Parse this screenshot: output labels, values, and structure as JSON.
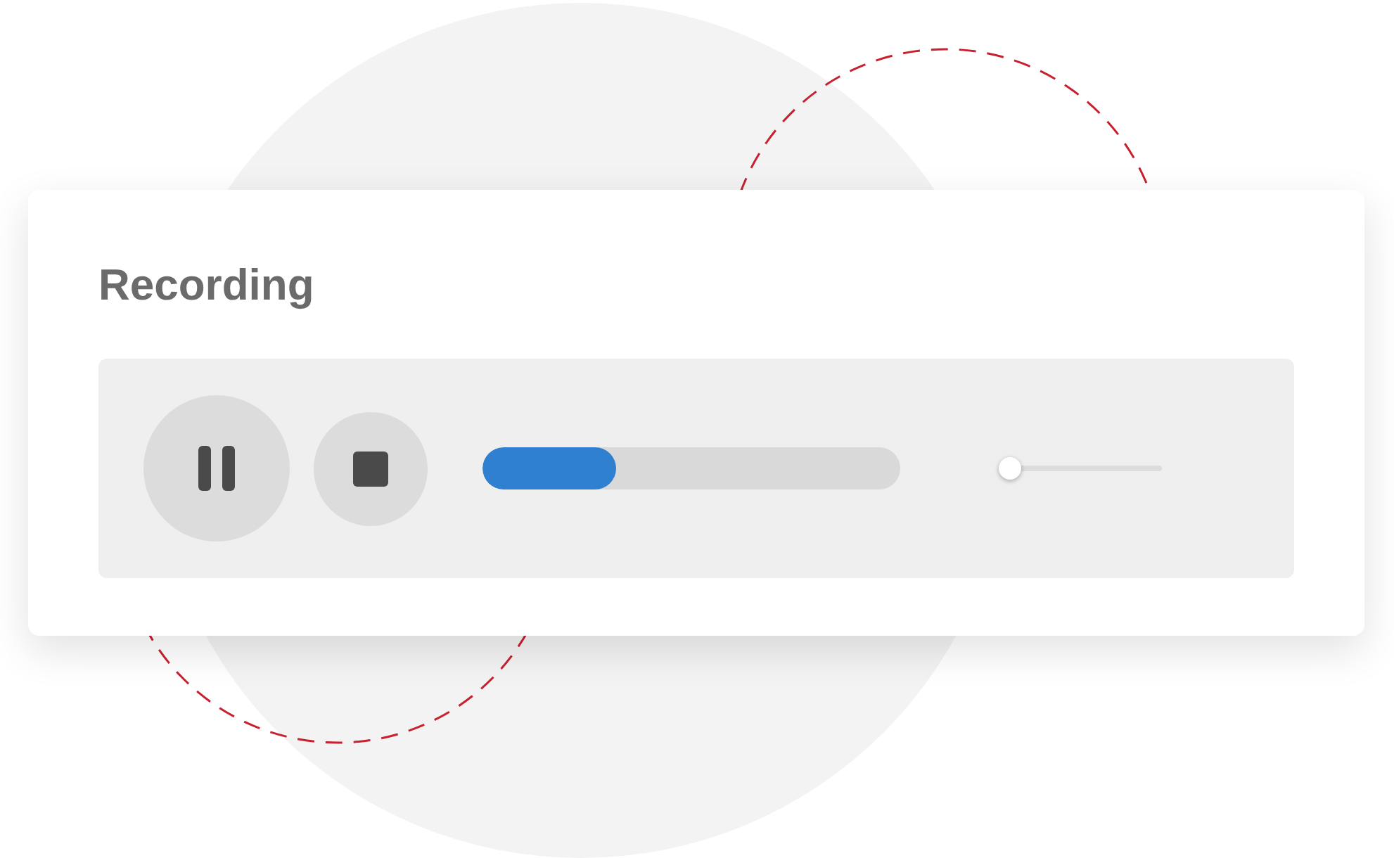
{
  "title": "Recording",
  "controls": [
    {
      "kind": "pause"
    },
    {
      "kind": "stop"
    }
  ],
  "progress": {
    "level": 0.32
  },
  "volume": {
    "level": 0.05
  }
}
